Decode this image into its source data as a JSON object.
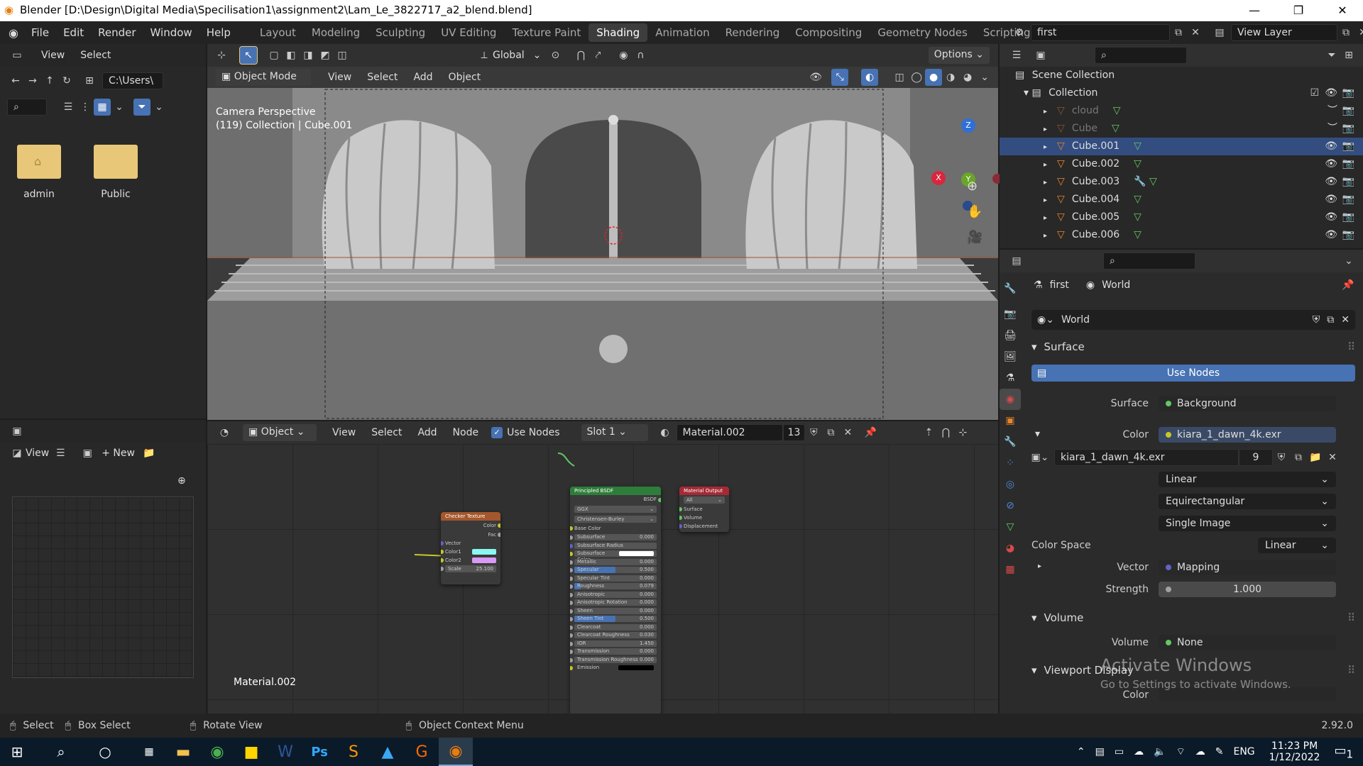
{
  "titlebar": {
    "title": "Blender [D:\\Design\\Digital Media\\Specilisation1\\assignment2\\Lam_Le_3822717_a2_blend.blend]"
  },
  "menu": [
    "File",
    "Edit",
    "Render",
    "Window",
    "Help"
  ],
  "workspaces": [
    "Layout",
    "Modeling",
    "Sculpting",
    "UV Editing",
    "Texture Paint",
    "Shading",
    "Animation",
    "Rendering",
    "Compositing",
    "Geometry Nodes",
    "Scripting"
  ],
  "active_workspace": "Shading",
  "scene": {
    "name": "first",
    "view_layer": "View Layer"
  },
  "filebrowser": {
    "view": "View",
    "select": "Select",
    "path": "C:\\Users\\",
    "folders": [
      "admin",
      "Public"
    ]
  },
  "image_editor": {
    "view": "View",
    "new": "New"
  },
  "viewport": {
    "orientation": "Global",
    "options": "Options",
    "mode": "Object Mode",
    "menus": [
      "View",
      "Select",
      "Add",
      "Object"
    ],
    "overlay_line1": "Camera Perspective",
    "overlay_line2": "(119) Collection | Cube.001",
    "axis_x": "X",
    "axis_y": "Y",
    "axis_z": "Z"
  },
  "node_editor": {
    "object": "Object",
    "menus": [
      "View",
      "Select",
      "Add",
      "Node"
    ],
    "use_nodes": "Use Nodes",
    "slot": "Slot 1",
    "material": "Material.002",
    "users": "13",
    "label": "Material.002",
    "checker": {
      "title": "Checker Texture",
      "out_color": "Color",
      "out_fac": "Fac",
      "in_vector": "Vector",
      "in_color1": "Color1",
      "in_color2": "Color2",
      "scale_label": "Scale",
      "scale": "25.100"
    },
    "bsdf": {
      "title": "Principled BSDF",
      "out": "BSDF",
      "dist": "GGX",
      "sss_method": "Christensen-Burley",
      "base_color": "Base Color",
      "rows": [
        [
          "Subsurface",
          "0.000"
        ],
        [
          "Subsurface Radius",
          ""
        ],
        [
          "Subsurface Color",
          ""
        ],
        [
          "Metallic",
          "0.000"
        ],
        [
          "Specular",
          "0.500"
        ],
        [
          "Specular Tint",
          "0.000"
        ],
        [
          "Roughness",
          "0.079"
        ],
        [
          "Anisotropic",
          "0.000"
        ],
        [
          "Anisotropic Rotation",
          "0.000"
        ],
        [
          "Sheen",
          "0.000"
        ],
        [
          "Sheen Tint",
          "0.500"
        ],
        [
          "Clearcoat",
          "0.000"
        ],
        [
          "Clearcoat Roughness",
          "0.030"
        ],
        [
          "IOR",
          "1.450"
        ],
        [
          "Transmission",
          "0.000"
        ],
        [
          "Transmission Roughness",
          "0.000"
        ],
        [
          "Emission",
          ""
        ]
      ]
    },
    "output": {
      "title": "Material Output",
      "target": "All",
      "rows": [
        "Surface",
        "Volume",
        "Displacement"
      ]
    }
  },
  "outliner": {
    "root": "Scene Collection",
    "collection": "Collection",
    "items": [
      "cloud",
      "Cube",
      "Cube.001",
      "Cube.002",
      "Cube.003",
      "Cube.004",
      "Cube.005",
      "Cube.006"
    ],
    "selected": "Cube.001"
  },
  "properties": {
    "breadcrumb_scene": "first",
    "breadcrumb_world": "World",
    "world_name": "World",
    "surface_header": "Surface",
    "use_nodes": "Use Nodes",
    "surface_label": "Surface",
    "surface_value": "Background",
    "color_label": "Color",
    "color_value": "kiara_1_dawn_4k.exr",
    "image_name": "kiara_1_dawn_4k.exr",
    "image_users": "9",
    "interpolation": "Linear",
    "projection": "Equirectangular",
    "source": "Single Image",
    "colorspace_label": "Color Space",
    "colorspace": "Linear",
    "vector_label": "Vector",
    "vector_value": "Mapping",
    "strength_label": "Strength",
    "strength": "1.000",
    "volume_header": "Volume",
    "volume_label": "Volume",
    "volume_value": "None",
    "viewport_display_header": "Viewport Display",
    "vd_color_label": "Color"
  },
  "watermark": {
    "line1": "Activate Windows",
    "line2": "Go to Settings to activate Windows."
  },
  "statusbar": {
    "select": "Select",
    "box_select": "Box Select",
    "rotate": "Rotate View",
    "context": "Object Context Menu",
    "version": "2.92.0"
  },
  "taskbar": {
    "lang": "ENG",
    "time": "11:23 PM",
    "date": "1/12/2022",
    "notif": "1"
  },
  "colors": {
    "accent": "#4772b3",
    "selected_row": "#334d80",
    "checker_header": "#a4572c",
    "bsdf_header": "#2e7d3a",
    "output_header": "#a52a35"
  }
}
